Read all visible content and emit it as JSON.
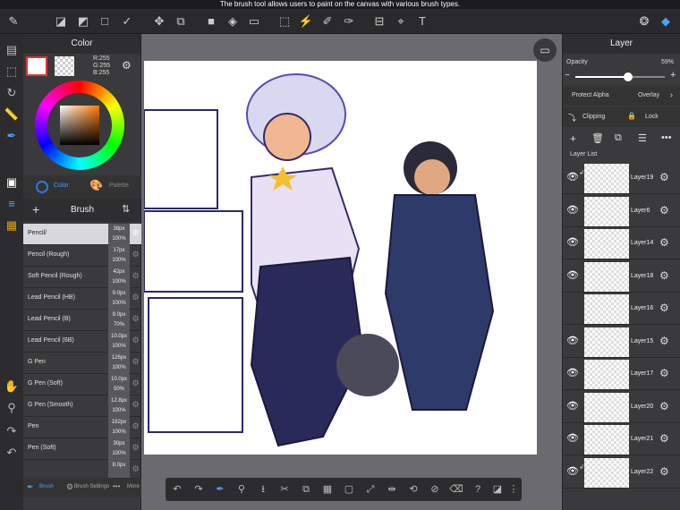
{
  "status": {
    "hint": "The brush tool allows users to paint on the canvas with various brush types."
  },
  "color_panel": {
    "title": "Color",
    "r": "R:255",
    "g": "G:255",
    "b": "B:255",
    "tab_color": "Color",
    "tab_palette": "Palette"
  },
  "brush_panel": {
    "title": "Brush",
    "items": [
      {
        "name": "Pencil/",
        "size": "38px",
        "opacity": "100%"
      },
      {
        "name": "Pencil (Rough)",
        "size": "17px",
        "opacity": "100%"
      },
      {
        "name": "Soft Pencil (Rough)",
        "size": "42px",
        "opacity": "100%"
      },
      {
        "name": "Lead Pencil (HB)",
        "size": "9.0px",
        "opacity": "100%"
      },
      {
        "name": "Lead Pencil (B)",
        "size": "9.0px",
        "opacity": "70%"
      },
      {
        "name": "Lead Pencil (6B)",
        "size": "10.0px",
        "opacity": "100%"
      },
      {
        "name": "G Pen",
        "size": "126px",
        "opacity": "100%"
      },
      {
        "name": "G Pen (Soft)",
        "size": "10.0px",
        "opacity": "50%"
      },
      {
        "name": "G Pen (Smooth)",
        "size": "12.8px",
        "opacity": "100%"
      },
      {
        "name": "Pen",
        "size": "182px",
        "opacity": "100%"
      },
      {
        "name": "Pen (Soft)",
        "size": "30px",
        "opacity": "100%"
      },
      {
        "name": "",
        "size": "8.0px",
        "opacity": ""
      }
    ],
    "footer_brush": "Brush",
    "footer_settings": "Brush Settings",
    "footer_more": "More"
  },
  "layer_panel": {
    "title": "Layer",
    "opacity_label": "Opacity",
    "opacity_value": "59%",
    "opacity_fraction": 0.59,
    "protect_alpha": "Protect Alpha",
    "blend_mode": "Overlay",
    "clipping": "Clipping",
    "lock": "Lock",
    "list_label": "Layer List",
    "layers": [
      {
        "name": "Layer19",
        "visible": true,
        "clip": true
      },
      {
        "name": "Layer6",
        "visible": true,
        "clip": false
      },
      {
        "name": "Layer14",
        "visible": true,
        "clip": false
      },
      {
        "name": "Layer18",
        "visible": true,
        "clip": false
      },
      {
        "name": "Layer16",
        "visible": false,
        "clip": false
      },
      {
        "name": "Layer15",
        "visible": true,
        "clip": false
      },
      {
        "name": "Layer17",
        "visible": true,
        "clip": false
      },
      {
        "name": "Layer20",
        "visible": true,
        "clip": false
      },
      {
        "name": "Layer21",
        "visible": true,
        "clip": false
      },
      {
        "name": "Layer22",
        "visible": true,
        "clip": true
      }
    ]
  },
  "colors": {
    "panel": "#3a3a3c",
    "selected_row": "#d8d8dc",
    "accent": "#2f7ad8"
  }
}
